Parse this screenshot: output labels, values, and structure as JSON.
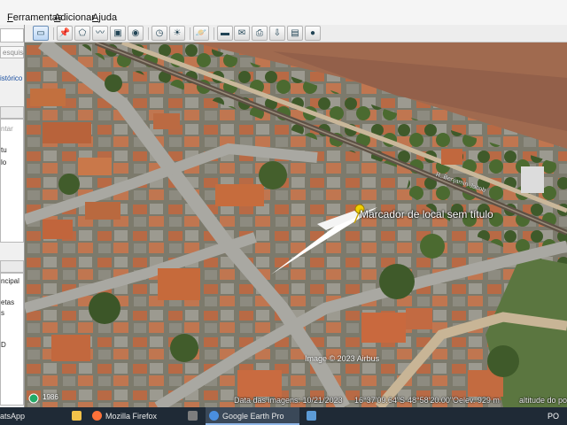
{
  "menu": {
    "items": [
      "Ferramentas",
      "Adicionar",
      "Ajuda"
    ],
    "mnemonics": [
      "F",
      "A",
      "A"
    ]
  },
  "toolbar": {
    "buttons": [
      {
        "icon": "sidebar-toggle-icon",
        "glyph": "▭"
      },
      {
        "icon": "placemark-icon",
        "glyph": "📌"
      },
      {
        "icon": "polygon-icon",
        "glyph": "⬠"
      },
      {
        "icon": "path-icon",
        "glyph": "〰"
      },
      {
        "icon": "image-overlay-icon",
        "glyph": "▣"
      },
      {
        "icon": "record-tour-icon",
        "glyph": "◉"
      },
      {
        "icon": "historical-imagery-icon",
        "glyph": "◷"
      },
      {
        "icon": "sunlight-icon",
        "glyph": "☀"
      },
      {
        "icon": "planets-icon",
        "glyph": "🪐"
      },
      {
        "icon": "ruler-icon",
        "glyph": "▬"
      },
      {
        "icon": "email-icon",
        "glyph": "✉"
      },
      {
        "icon": "print-icon",
        "glyph": "⎙"
      },
      {
        "icon": "save-image-icon",
        "glyph": "⇩"
      },
      {
        "icon": "view-in-maps-icon",
        "glyph": "▤"
      },
      {
        "icon": "earth-gallery-icon",
        "glyph": "●"
      }
    ]
  },
  "sidebar": {
    "search_button": "esquisar",
    "history_link": "istórico",
    "places_fragment_1": "ntar",
    "places_fragment_2": "tu",
    "places_fragment_3": "lo",
    "layers_fragment_1": "ncipal",
    "layers_fragment_2": "etas",
    "layers_fragment_3": "s",
    "layers_fragment_4": "D"
  },
  "map": {
    "placemark_label": "Marcador de local sem título",
    "road_label": "R. Benjamin Jacob",
    "copyright": "Image © 2023 Airbus",
    "year_badge": "1986"
  },
  "status": {
    "imagery_date": "Data das imagens: 10/21/2023",
    "lat": "16°37'09.64\"S",
    "lon": "48°58'20.00\"O",
    "elev": "elev. 929 m",
    "eye_alt": "altitude do ponto"
  },
  "taskbar": {
    "items": [
      {
        "label": "atsApp",
        "icon": "whatsapp-icon",
        "color": "#25d366"
      },
      {
        "label": "",
        "icon": "file-explorer-icon",
        "color": "#f3c24a"
      },
      {
        "label": "Mozilla Firefox",
        "icon": "firefox-icon",
        "color": "#ff7139"
      },
      {
        "label": "",
        "icon": "calculator-icon",
        "color": "#7d7d7d"
      },
      {
        "label": "Google Earth Pro",
        "icon": "google-earth-icon",
        "color": "#4a8fe0"
      },
      {
        "label": "",
        "icon": "app-window-icon",
        "color": "#5c9bd6"
      }
    ],
    "lang": "PO"
  }
}
